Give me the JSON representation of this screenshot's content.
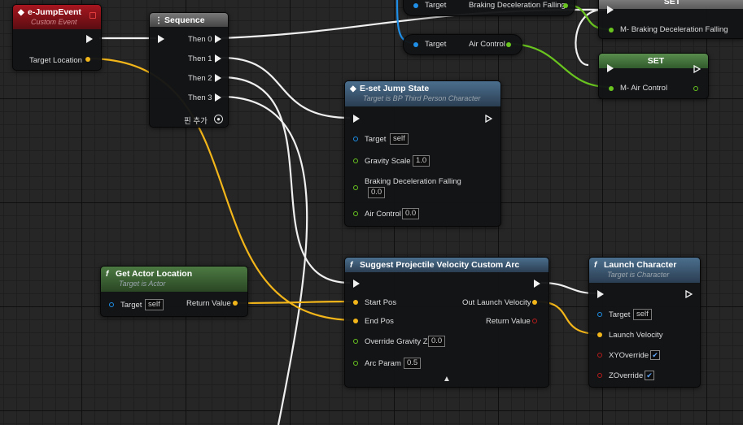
{
  "nodes": {
    "jump_event": {
      "title": "e-JumpEvent",
      "subtitle": "Custom Event",
      "target_location": "Target Location"
    },
    "sequence": {
      "title": "Sequence",
      "then0": "Then 0",
      "then1": "Then 1",
      "then2": "Then 2",
      "then3": "Then 3",
      "add_pin": "핀 추가"
    },
    "set_jump_state": {
      "title": "E-set Jump State",
      "subtitle": "Target is BP Third Person Character",
      "target": "Target",
      "target_val": "self",
      "gravity_scale": "Gravity Scale",
      "gravity_scale_val": "1.0",
      "braking": "Braking Deceleration Falling",
      "braking_val": "0.0",
      "air_control": "Air Control",
      "air_control_val": "0.0"
    },
    "get_actor_location": {
      "title": "Get Actor Location",
      "subtitle": "Target is Actor",
      "target": "Target",
      "target_val": "self",
      "return_value": "Return Value"
    },
    "suggest_projectile": {
      "title": "Suggest Projectile Velocity Custom Arc",
      "start_pos": "Start Pos",
      "end_pos": "End Pos",
      "override_gravity": "Override Gravity Z",
      "override_gravity_val": "0.0",
      "arc_param": "Arc Param",
      "arc_param_val": "0.5",
      "out_launch_velocity": "Out Launch Velocity",
      "return_value": "Return Value"
    },
    "launch_character": {
      "title": "Launch Character",
      "subtitle": "Target is Character",
      "target": "Target",
      "target_val": "self",
      "launch_velocity": "Launch Velocity",
      "xy_override": "XYOverride",
      "z_override": "ZOverride"
    },
    "top_braking": {
      "target": "Target",
      "output": "Braking Deceleration Falling"
    },
    "top_air": {
      "target": "Target",
      "output": "Air Control"
    },
    "set1": {
      "title": "SET",
      "input": "M- Braking Deceleration Falling"
    },
    "set2": {
      "title": "SET",
      "input": "M- Air Control"
    }
  },
  "colors": {
    "exec": "#f0f0f0",
    "vector": "#f3b61a",
    "object": "#1f8fe8",
    "float": "#69c41f",
    "bool": "#b91c1c"
  }
}
